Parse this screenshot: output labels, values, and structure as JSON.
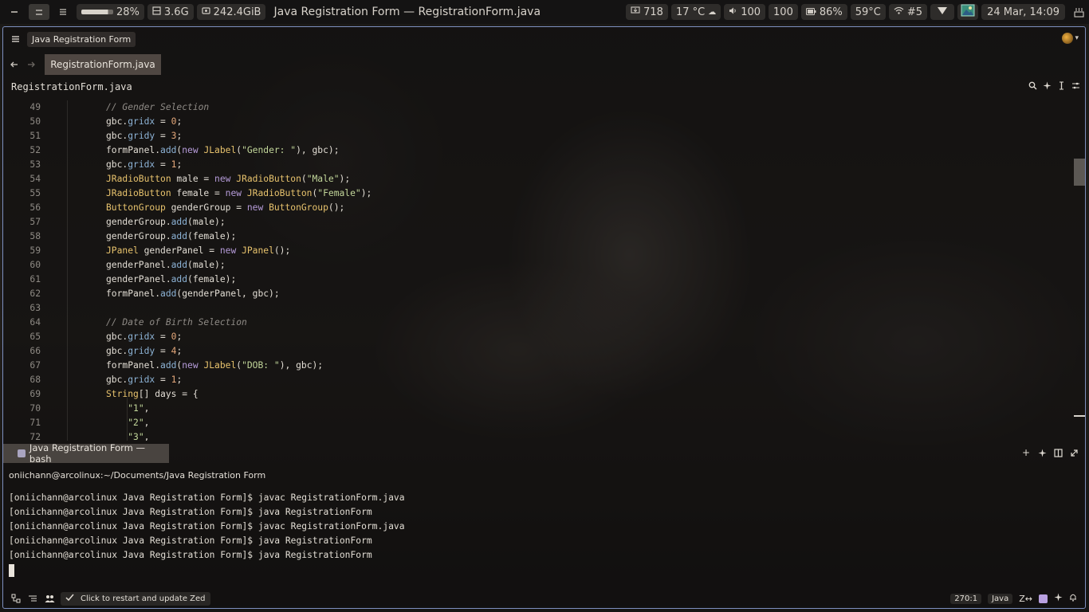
{
  "topbar": {
    "cpu_label": "28%",
    "cpu_fill": 0.28,
    "memory": "3.6G",
    "disk": "242.4GiB",
    "window_title": "Java Registration Form — RegistrationForm.java",
    "updates": "718",
    "weather": "17 °C",
    "volume": "100",
    "brightness": "100",
    "battery": "86%",
    "temperature": "59°C",
    "wifi": "#5",
    "datetime": "24 Mar, 14:09"
  },
  "window": {
    "project_name": "Java Registration Form",
    "tab_label": "RegistrationForm.java",
    "breadcrumb": "RegistrationForm.java"
  },
  "editor": {
    "lines": [
      {
        "n": "49",
        "tokens": [
          [
            "c",
            "// Gender Selection"
          ]
        ]
      },
      {
        "n": "50",
        "tokens": [
          [
            "p",
            "gbc."
          ],
          [
            "f",
            "gridx"
          ],
          [
            "p",
            " = "
          ],
          [
            "n",
            "0"
          ],
          [
            "p",
            ";"
          ]
        ]
      },
      {
        "n": "51",
        "tokens": [
          [
            "p",
            "gbc."
          ],
          [
            "f",
            "gridy"
          ],
          [
            "p",
            " = "
          ],
          [
            "n",
            "3"
          ],
          [
            "p",
            ";"
          ]
        ]
      },
      {
        "n": "52",
        "tokens": [
          [
            "p",
            "formPanel."
          ],
          [
            "f",
            "add"
          ],
          [
            "p",
            "("
          ],
          [
            "k",
            "new"
          ],
          [
            "p",
            " "
          ],
          [
            "t",
            "JLabel"
          ],
          [
            "p",
            "("
          ],
          [
            "s",
            "\"Gender: \""
          ],
          [
            "p",
            "), gbc);"
          ]
        ]
      },
      {
        "n": "53",
        "tokens": [
          [
            "p",
            "gbc."
          ],
          [
            "f",
            "gridx"
          ],
          [
            "p",
            " = "
          ],
          [
            "n",
            "1"
          ],
          [
            "p",
            ";"
          ]
        ]
      },
      {
        "n": "54",
        "tokens": [
          [
            "t",
            "JRadioButton"
          ],
          [
            "p",
            " male = "
          ],
          [
            "k",
            "new"
          ],
          [
            "p",
            " "
          ],
          [
            "t",
            "JRadioButton"
          ],
          [
            "p",
            "("
          ],
          [
            "s",
            "\"Male\""
          ],
          [
            "p",
            ");"
          ]
        ]
      },
      {
        "n": "55",
        "tokens": [
          [
            "t",
            "JRadioButton"
          ],
          [
            "p",
            " female = "
          ],
          [
            "k",
            "new"
          ],
          [
            "p",
            " "
          ],
          [
            "t",
            "JRadioButton"
          ],
          [
            "p",
            "("
          ],
          [
            "s",
            "\"Female\""
          ],
          [
            "p",
            ");"
          ]
        ]
      },
      {
        "n": "56",
        "tokens": [
          [
            "t",
            "ButtonGroup"
          ],
          [
            "p",
            " genderGroup = "
          ],
          [
            "k",
            "new"
          ],
          [
            "p",
            " "
          ],
          [
            "t",
            "ButtonGroup"
          ],
          [
            "p",
            "();"
          ]
        ]
      },
      {
        "n": "57",
        "tokens": [
          [
            "p",
            "genderGroup."
          ],
          [
            "f",
            "add"
          ],
          [
            "p",
            "(male);"
          ]
        ]
      },
      {
        "n": "58",
        "tokens": [
          [
            "p",
            "genderGroup."
          ],
          [
            "f",
            "add"
          ],
          [
            "p",
            "(female);"
          ]
        ]
      },
      {
        "n": "59",
        "tokens": [
          [
            "t",
            "JPanel"
          ],
          [
            "p",
            " genderPanel = "
          ],
          [
            "k",
            "new"
          ],
          [
            "p",
            " "
          ],
          [
            "t",
            "JPanel"
          ],
          [
            "p",
            "();"
          ]
        ]
      },
      {
        "n": "60",
        "tokens": [
          [
            "p",
            "genderPanel."
          ],
          [
            "f",
            "add"
          ],
          [
            "p",
            "(male);"
          ]
        ]
      },
      {
        "n": "61",
        "tokens": [
          [
            "p",
            "genderPanel."
          ],
          [
            "f",
            "add"
          ],
          [
            "p",
            "(female);"
          ]
        ]
      },
      {
        "n": "62",
        "tokens": [
          [
            "p",
            "formPanel."
          ],
          [
            "f",
            "add"
          ],
          [
            "p",
            "(genderPanel, gbc);"
          ]
        ]
      },
      {
        "n": "63",
        "tokens": []
      },
      {
        "n": "64",
        "tokens": [
          [
            "c",
            "// Date of Birth Selection"
          ]
        ]
      },
      {
        "n": "65",
        "tokens": [
          [
            "p",
            "gbc."
          ],
          [
            "f",
            "gridx"
          ],
          [
            "p",
            " = "
          ],
          [
            "n",
            "0"
          ],
          [
            "p",
            ";"
          ]
        ]
      },
      {
        "n": "66",
        "tokens": [
          [
            "p",
            "gbc."
          ],
          [
            "f",
            "gridy"
          ],
          [
            "p",
            " = "
          ],
          [
            "n",
            "4"
          ],
          [
            "p",
            ";"
          ]
        ]
      },
      {
        "n": "67",
        "tokens": [
          [
            "p",
            "formPanel."
          ],
          [
            "f",
            "add"
          ],
          [
            "p",
            "("
          ],
          [
            "k",
            "new"
          ],
          [
            "p",
            " "
          ],
          [
            "t",
            "JLabel"
          ],
          [
            "p",
            "("
          ],
          [
            "s",
            "\"DOB: \""
          ],
          [
            "p",
            "), gbc);"
          ]
        ]
      },
      {
        "n": "68",
        "tokens": [
          [
            "p",
            "gbc."
          ],
          [
            "f",
            "gridx"
          ],
          [
            "p",
            " = "
          ],
          [
            "n",
            "1"
          ],
          [
            "p",
            ";"
          ]
        ]
      },
      {
        "n": "69",
        "tokens": [
          [
            "t",
            "String"
          ],
          [
            "p",
            "[] days = {"
          ]
        ]
      },
      {
        "n": "70",
        "tokens": [
          [
            "p",
            "    "
          ],
          [
            "s",
            "\"1\""
          ],
          [
            "p",
            ","
          ]
        ]
      },
      {
        "n": "71",
        "tokens": [
          [
            "p",
            "    "
          ],
          [
            "s",
            "\"2\""
          ],
          [
            "p",
            ","
          ]
        ]
      },
      {
        "n": "72",
        "tokens": [
          [
            "p",
            "    "
          ],
          [
            "s",
            "\"3\""
          ],
          [
            "p",
            ","
          ]
        ]
      }
    ]
  },
  "terminal": {
    "tab_label": "Java Registration Form — bash",
    "cwd_title": "oniichann@arcolinux:~/Documents/Java Registration Form",
    "lines": [
      "[oniichann@arcolinux Java Registration Form]$ javac RegistrationForm.java",
      "[oniichann@arcolinux Java Registration Form]$ java RegistrationForm",
      "[oniichann@arcolinux Java Registration Form]$ javac RegistrationForm.java",
      "[oniichann@arcolinux Java Registration Form]$ java RegistrationForm",
      "[oniichann@arcolinux Java Registration Form]$ java RegistrationForm"
    ]
  },
  "statusbar": {
    "update_label": "Click to restart and update Zed",
    "cursor_position": "270:1",
    "language": "Java"
  },
  "icons": [
    "minimize-icon",
    "workspace-icon",
    "menu-icon",
    "memory-icon",
    "disk-icon",
    "update-icon",
    "weather-icon",
    "volume-icon",
    "battery-icon",
    "wifi-icon",
    "vpn-icon",
    "image-icon",
    "notification-icon",
    "hamburger-icon",
    "back-arrow-icon",
    "forward-arrow-icon",
    "search-icon",
    "sparkle-icon",
    "cursor-icon",
    "settings-icon",
    "plus-icon",
    "split-icon",
    "maximize-icon",
    "terminal-icon",
    "project-panel-icon",
    "outline-icon",
    "collab-icon",
    "check-icon",
    "copilot-icon",
    "bell-icon"
  ]
}
